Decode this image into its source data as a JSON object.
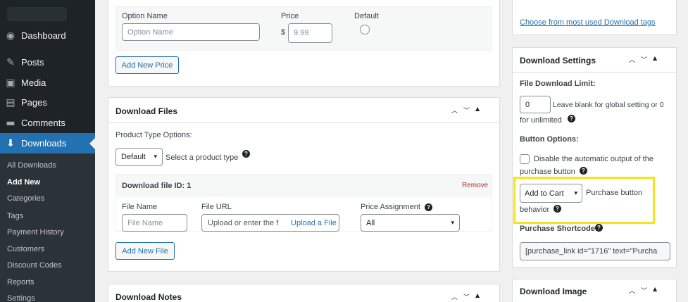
{
  "sidebar": {
    "menu": [
      {
        "label": "Dashboard",
        "icon": "dashboard-icon"
      },
      {
        "label": "Posts",
        "icon": "pin-icon"
      },
      {
        "label": "Media",
        "icon": "media-icon"
      },
      {
        "label": "Pages",
        "icon": "pages-icon"
      },
      {
        "label": "Comments",
        "icon": "comment-icon"
      },
      {
        "label": "Downloads",
        "icon": "download-icon"
      }
    ],
    "submenu": [
      "All Downloads",
      "Add New",
      "Categories",
      "Tags",
      "Payment History",
      "Customers",
      "Discount Codes",
      "Reports",
      "Settings"
    ],
    "current_sub": "Add New"
  },
  "prices": {
    "option_name_label": "Option Name",
    "option_name_placeholder": "Option Name",
    "price_label": "Price",
    "currency": "$",
    "price_placeholder": "9.99",
    "default_label": "Default",
    "add_price_button": "Add New Price"
  },
  "files": {
    "title": "Download Files",
    "product_type_label": "Product Type Options:",
    "product_type_value": "Default",
    "product_type_hint": "Select a product type",
    "file_id_label": "Download file ID: 1",
    "remove_label": "Remove",
    "file_name_label": "File Name",
    "file_name_placeholder": "File Name",
    "file_url_label": "File URL",
    "file_url_placeholder": "Upload or enter the f",
    "upload_label": "Upload a File",
    "price_assignment_label": "Price Assignment",
    "price_assignment_value": "All",
    "add_file_button": "Add New File"
  },
  "notes": {
    "title": "Download Notes"
  },
  "tags_link": "Choose from most used Download tags",
  "settings": {
    "title": "Download Settings",
    "limit_label": "File Download Limit:",
    "limit_value": "0",
    "limit_hint_1": "Leave blank for global setting or 0",
    "limit_hint_2": "for unlimited",
    "button_options_label": "Button Options:",
    "disable_output_1": "Disable the automatic output of the",
    "disable_output_2": "purchase button",
    "behavior_value": "Add to Cart",
    "behavior_label_1": "Purchase button",
    "behavior_label_2": "behavior",
    "shortcode_label": "Purchase Shortcode:",
    "shortcode_value": "[purchase_link id=\"1716\" text=\"Purcha"
  },
  "image_panel": {
    "title": "Download Image"
  },
  "colors": {
    "accent": "#2271b1",
    "highlight": "#f2e51d",
    "remove": "#b32d2e"
  }
}
